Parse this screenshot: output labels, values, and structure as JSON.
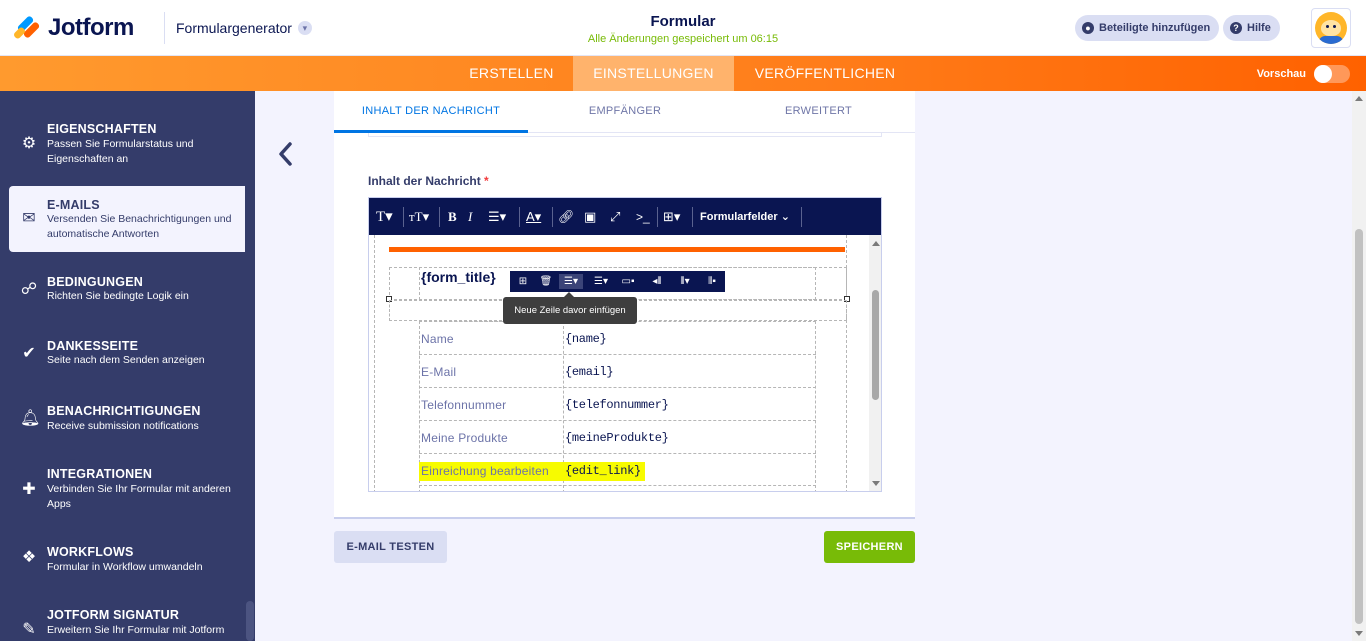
{
  "header": {
    "logo_text": "Jotform",
    "generator_label": "Formulargenerator",
    "form_title": "Formular",
    "save_status": "Alle Änderungen gespeichert um 06:15",
    "add_participants_label": "Beteiligte hinzufügen",
    "help_label": "Hilfe"
  },
  "nav": {
    "tabs": [
      {
        "label": "ERSTELLEN"
      },
      {
        "label": "EINSTELLUNGEN"
      },
      {
        "label": "VERÖFFENTLICHEN"
      }
    ],
    "active_tab": "EINSTELLUNGEN",
    "preview_label": "Vorschau",
    "preview_on": false
  },
  "sidebar": {
    "items": [
      {
        "title": "EIGENSCHAFTEN",
        "desc": "Passen Sie Formularstatus und Eigenschaften an",
        "icon": "gear-icon"
      },
      {
        "title": "E-MAILS",
        "desc": "Versenden Sie Benachrichtigungen und automatische Antworten",
        "icon": "envelope-icon",
        "active": true
      },
      {
        "title": "BEDINGUNGEN",
        "desc": "Richten Sie bedingte Logik ein",
        "icon": "sitemap-icon"
      },
      {
        "title": "DANKESSEITE",
        "desc": "Seite nach dem Senden anzeigen",
        "icon": "check-circle-icon"
      },
      {
        "title": "BENACHRICHTIGUNGEN",
        "desc": "Receive submission notifications",
        "icon": "bell-icon"
      },
      {
        "title": "INTEGRATIONEN",
        "desc": "Verbinden Sie Ihr Formular mit anderen Apps",
        "icon": "puzzle-icon"
      },
      {
        "title": "WORKFLOWS",
        "desc": "Formular in Workflow umwandeln",
        "icon": "workflow-icon"
      },
      {
        "title": "JOTFORM SIGNATUR",
        "desc": "Erweitern Sie Ihr Formular mit Jotform",
        "icon": "signature-icon"
      }
    ]
  },
  "email_tabs": [
    {
      "label": "INHALT DER NACHRICHT"
    },
    {
      "label": "EMPFÄNGER"
    },
    {
      "label": "ERWEITERT"
    }
  ],
  "message": {
    "label": "Inhalt der Nachricht",
    "required_mark": "*",
    "toolbar_fields_label": "Formularfelder",
    "form_title_tag": "{form_title}",
    "tooltip": "Neue Zeile davor einfügen",
    "rows": [
      {
        "label": "Name",
        "value": "{name}"
      },
      {
        "label": "E-Mail",
        "value": "{email}"
      },
      {
        "label": "Telefonnummer",
        "value": "{telefonnummer}"
      },
      {
        "label": "Meine Produkte",
        "value": "{meineProdukte}"
      },
      {
        "label": "Einreichung bearbeiten",
        "value": "{edit_link}",
        "highlight": true
      }
    ]
  },
  "actions": {
    "test_label": "E-MAIL TESTEN",
    "save_label": "SPEICHERN"
  },
  "colors": {
    "brand_orange": "#ff6100",
    "navy": "#0a1551",
    "sidebar_bg": "#343c6a",
    "success_green": "#78bb07",
    "link_blue": "#0075e3",
    "highlight_yellow": "#f7fb00"
  }
}
